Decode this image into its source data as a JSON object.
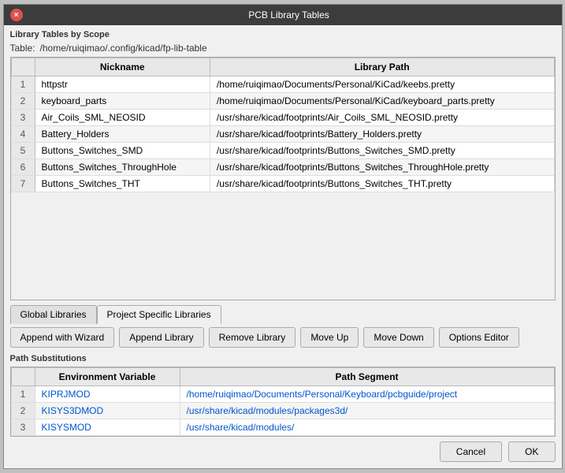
{
  "window": {
    "title": "PCB Library Tables",
    "close_label": "×"
  },
  "scope_label": "Library Tables by Scope",
  "table_path_label": "Table:",
  "table_path_value": "/home/ruiqimao/.config/kicad/fp-lib-table",
  "main_table": {
    "columns": [
      "Nickname",
      "Library Path"
    ],
    "rows": [
      {
        "num": "1",
        "nickname": "httpstr",
        "path": "/home/ruiqimao/Documents/Personal/KiCad/keebs.pretty"
      },
      {
        "num": "2",
        "nickname": "keyboard_parts",
        "path": "/home/ruiqimao/Documents/Personal/KiCad/keyboard_parts.pretty"
      },
      {
        "num": "3",
        "nickname": "Air_Coils_SML_NEOSID",
        "path": "/usr/share/kicad/footprints/Air_Coils_SML_NEOSID.pretty"
      },
      {
        "num": "4",
        "nickname": "Battery_Holders",
        "path": "/usr/share/kicad/footprints/Battery_Holders.pretty"
      },
      {
        "num": "5",
        "nickname": "Buttons_Switches_SMD",
        "path": "/usr/share/kicad/footprints/Buttons_Switches_SMD.pretty"
      },
      {
        "num": "6",
        "nickname": "Buttons_Switches_ThroughHole",
        "path": "/usr/share/kicad/footprints/Buttons_Switches_ThroughHole.pretty"
      },
      {
        "num": "7",
        "nickname": "Buttons_Switches_THT",
        "path": "/usr/share/kicad/footprints/Buttons_Switches_THT.pretty"
      }
    ]
  },
  "tabs": [
    {
      "label": "Global Libraries",
      "active": false
    },
    {
      "label": "Project Specific Libraries",
      "active": true
    }
  ],
  "action_buttons": [
    {
      "label": "Append with Wizard"
    },
    {
      "label": "Append Library"
    },
    {
      "label": "Remove Library"
    },
    {
      "label": "Move Up"
    },
    {
      "label": "Move Down"
    },
    {
      "label": "Options Editor"
    }
  ],
  "path_sub_label": "Path Substitutions",
  "path_sub_table": {
    "columns": [
      "Environment Variable",
      "Path Segment"
    ],
    "rows": [
      {
        "num": "1",
        "env_var": "KIPRJMOD",
        "path": "/home/ruiqimao/Documents/Personal/Keyboard/pcbguide/project"
      },
      {
        "num": "2",
        "env_var": "KISYS3DMOD",
        "path": "/usr/share/kicad/modules/packages3d/"
      },
      {
        "num": "3",
        "env_var": "KISYSMOD",
        "path": "/usr/share/kicad/modules/"
      }
    ]
  },
  "footer": {
    "cancel_label": "Cancel",
    "ok_label": "OK"
  }
}
